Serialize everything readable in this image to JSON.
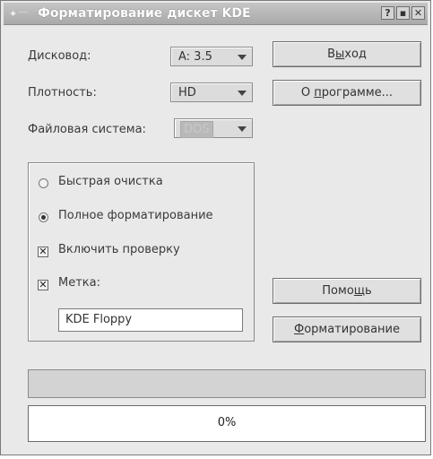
{
  "window": {
    "title": "Форматирование дискет KDE",
    "controls": {
      "help": "?",
      "minimize": "▪",
      "close": "✕"
    }
  },
  "fields": {
    "drive_label": "Дисковод:",
    "drive_value": "A: 3.5",
    "density_label": "Плотность:",
    "density_value": "HD",
    "filesystem_label": "Файловая система:",
    "filesystem_value": "DOS"
  },
  "buttons": {
    "exit": {
      "pre": "В",
      "u": "ы",
      "post": "ход"
    },
    "about": {
      "pre": "О ",
      "u": "п",
      "post": "рограмме..."
    },
    "help": {
      "pre": "Помо",
      "u": "щ",
      "post": "ь"
    },
    "format": {
      "pre": "",
      "u": "Ф",
      "post": "орматирование"
    }
  },
  "options": {
    "quick_erase": "Быстрая очистка",
    "full_format": "Полное форматирование",
    "verify": "Включить проверку",
    "label": "Метка:",
    "label_value": "KDE Floppy",
    "selected_mode": "full_format",
    "verify_checked": true,
    "label_checked": true
  },
  "progress": {
    "value": 0,
    "text": "0%"
  }
}
